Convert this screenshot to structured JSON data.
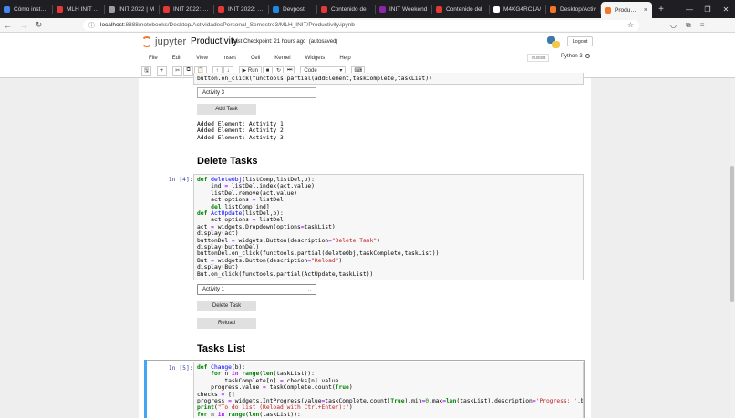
{
  "browser": {
    "tabs": [
      {
        "title": "Cómo instalar",
        "color": "#4285f4"
      },
      {
        "title": "MLH INIT 2021",
        "color": "#e53935"
      },
      {
        "title": "INIT 2022 | M",
        "color": "#9e9e9e"
      },
      {
        "title": "INIT 2022: Day",
        "color": "#e53935"
      },
      {
        "title": "INIT 2022: Day",
        "color": "#e53935"
      },
      {
        "title": "Devpost",
        "color": "#1e88e5"
      },
      {
        "title": "Contenido del",
        "color": "#e53935"
      },
      {
        "title": "INIT Weekend",
        "color": "#8e24aa"
      },
      {
        "title": "Contenido del",
        "color": "#e53935"
      },
      {
        "title": "M4XG4RC1A/",
        "color": "#ffffff"
      },
      {
        "title": "Desktop/Activ",
        "color": "#f37726"
      },
      {
        "title": "Productivity",
        "color": "#f37726"
      }
    ],
    "url_host": "localhost",
    "url_path": ":8888/notebooks/Desktop/ActividadesPersonal_Semestre3/MLH_INIT/Productivity.ipynb"
  },
  "jupyter": {
    "logo_text": "jupyter",
    "notebook_name": "Productivity",
    "checkpoint": "Last Checkpoint: 21 hours ago",
    "autosave": "(autosaved)",
    "logout": "Logout",
    "menu": [
      "File",
      "Edit",
      "View",
      "Insert",
      "Cell",
      "Kernel",
      "Widgets",
      "Help"
    ],
    "trusted": "Trusted",
    "kernel": "Python 3",
    "run_label": "Run",
    "cell_type": "Code"
  },
  "cells": {
    "top_code_fragment": "button.on_click(functools.partial(addElement,taskComplete,taskList))",
    "add_text_value": "Activity 3",
    "add_task_button": "Add Task",
    "added_output": "Added Element: Activity 1\nAdded Element: Activity 2\nAdded Element: Activity 3",
    "delete_heading": "Delete Tasks",
    "prompt4": "In [4]:",
    "dropdown_value": "Activity 1",
    "delete_button": "Delete Task",
    "reload_button": "Reload",
    "list_heading": "Tasks List",
    "prompt5": "In [5]:"
  }
}
